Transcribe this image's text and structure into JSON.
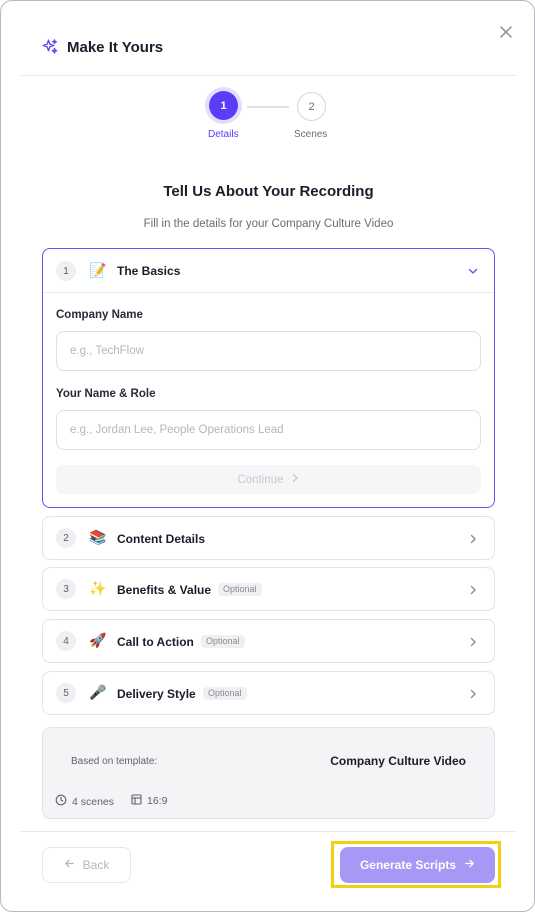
{
  "dialog": {
    "title": "Make It Yours",
    "close_label": "×"
  },
  "stepper": {
    "steps": [
      {
        "number": "1",
        "label": "Details",
        "active": true
      },
      {
        "number": "2",
        "label": "Scenes",
        "active": false
      }
    ]
  },
  "intro": {
    "title": "Tell Us About Your Recording",
    "subtitle": "Fill in the details for your Company Culture Video"
  },
  "sections": [
    {
      "number": "1",
      "emoji": "📝",
      "title": "The Basics",
      "optional": "",
      "expanded": true
    },
    {
      "number": "2",
      "emoji": "📚",
      "title": "Content Details",
      "optional": "",
      "expanded": false
    },
    {
      "number": "3",
      "emoji": "✨",
      "title": "Benefits & Value",
      "optional": "Optional",
      "expanded": false
    },
    {
      "number": "4",
      "emoji": "🚀",
      "title": "Call to Action",
      "optional": "Optional",
      "expanded": false
    },
    {
      "number": "5",
      "emoji": "🎤",
      "title": "Delivery Style",
      "optional": "Optional",
      "expanded": false
    }
  ],
  "basics_form": {
    "company_name": {
      "label": "Company Name",
      "value": "",
      "placeholder": "e.g., TechFlow"
    },
    "name_role": {
      "label": "Your Name & Role",
      "value": "",
      "placeholder": "e.g., Jordan Lee, People Operations Lead"
    },
    "continue_label": "Continue"
  },
  "template": {
    "based_on_label": "Based on template:",
    "name": "Company Culture Video",
    "scenes": "4 scenes",
    "aspect_ratio": "16:9"
  },
  "footer": {
    "back_label": "Back",
    "generate_label": "Generate Scripts"
  },
  "colors": {
    "accent": "#5b3df5",
    "generate_button": "#a699f6",
    "highlight": "#f4cf10"
  },
  "icons": {
    "header": "sparkle-icon",
    "close": "close-icon",
    "expanded": "chevron-down-icon",
    "collapsed": "chevron-right-icon",
    "scenes": "clock-icon",
    "aspect": "frame-icon",
    "back": "arrow-left-icon",
    "generate": "arrow-right-icon"
  }
}
